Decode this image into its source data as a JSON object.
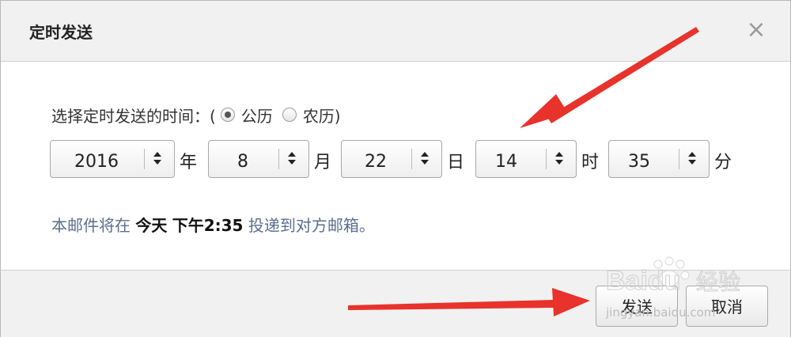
{
  "dialog": {
    "title": "定时发送",
    "close_symbol": "×"
  },
  "prompt": {
    "text": "选择定时发送的时间：(",
    "option_gregorian": "公历",
    "option_lunar": "农历)",
    "selected": "公历"
  },
  "date_time": {
    "year": {
      "value": "2016",
      "unit": "年"
    },
    "month": {
      "value": "8",
      "unit": "月"
    },
    "day": {
      "value": "22",
      "unit": "日"
    },
    "hour": {
      "value": "14",
      "unit": "时"
    },
    "minute": {
      "value": "35",
      "unit": "分"
    }
  },
  "info": {
    "prefix": "本邮件将在",
    "day": "今天",
    "time": "下午2:35",
    "suffix": "投递到对方邮箱。"
  },
  "buttons": {
    "send": "发送",
    "cancel": "取消"
  },
  "watermark": {
    "brand": "Baidu",
    "cn": "经验",
    "url": "jingyan.baidu.com"
  },
  "colors": {
    "arrow": "#e8322c",
    "info_text": "#5a6f8e",
    "header_bg": "#f1f1f1"
  }
}
